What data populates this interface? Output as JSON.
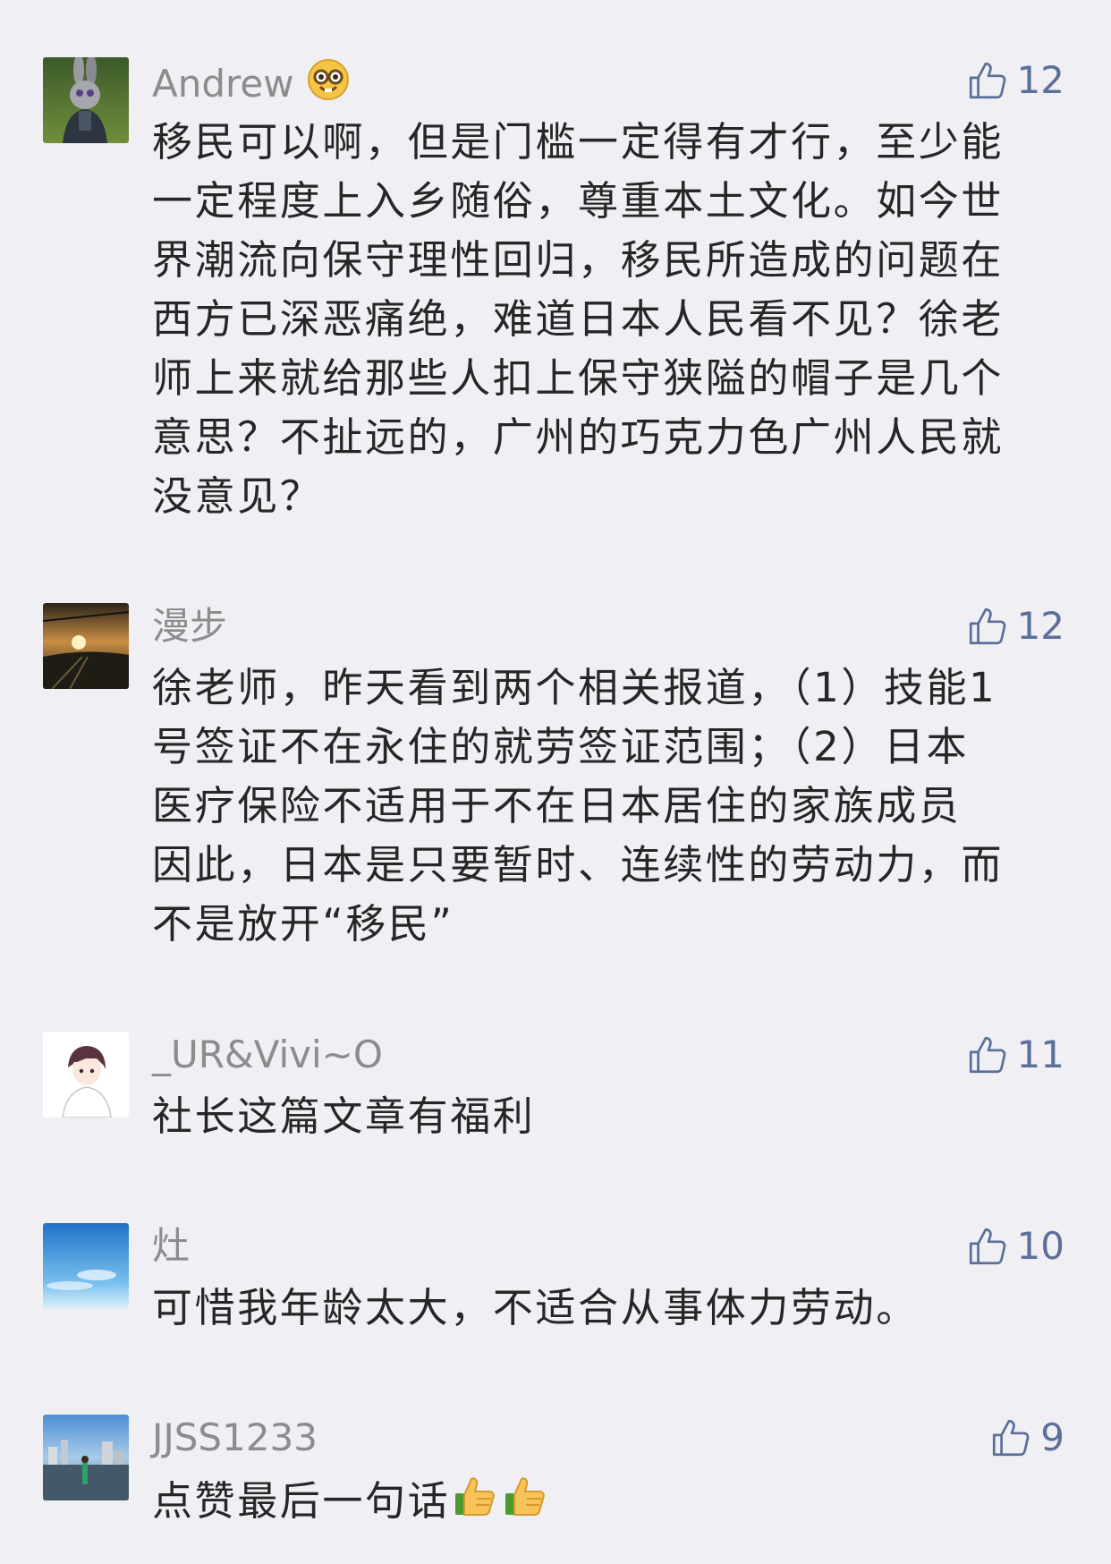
{
  "colors": {
    "background": "#efeff4",
    "name": "#8c8c8c",
    "like": "#5b6f99",
    "text": "#262626"
  },
  "comments": [
    {
      "author": "Andrew",
      "author_emoji": "nerd-face-emoji",
      "avatar": "rabbit-avatar",
      "likes": "12",
      "lines": [
        "移民可以啊，但是门槛一定得有才行，至少能",
        "一定程度上入乡随俗，尊重本土文化。如今世",
        "界潮流向保守理性回归，移民所造成的问题在",
        "西方已深恶痛绝，难道日本人民看不见？徐老",
        "师上来就给那些人扣上保守狭隘的帽子是几个",
        "意思？不扯远的，广州的巧克力色广州人民就",
        "没意见？"
      ]
    },
    {
      "author": "漫步",
      "avatar": "sunset-railway-avatar",
      "likes": "12",
      "lines": [
        "徐老师，昨天看到两个相关报道，（1）技能1",
        "号签证不在永住的就劳签证范围；（2）日本",
        "医疗保险不适用于不在日本居住的家族成员",
        "因此，日本是只要暂时、连续性的劳动力，而",
        "不是放开“移民”"
      ]
    },
    {
      "author": "_UR&Vivi~O",
      "avatar": "anime-boy-avatar",
      "likes": "11",
      "lines": [
        "社长这篇文章有福利"
      ]
    },
    {
      "author": "灶",
      "avatar": "blue-sky-avatar",
      "likes": "10",
      "lines": [
        "可惜我年龄太大，不适合从事体力劳动。"
      ]
    },
    {
      "author": "JJSS1233",
      "avatar": "city-waterfront-avatar",
      "likes": "9",
      "lines": [
        "点赞最后一句话"
      ],
      "trailing_emojis": [
        "thumbs-up-emoji",
        "thumbs-up-emoji"
      ]
    }
  ]
}
